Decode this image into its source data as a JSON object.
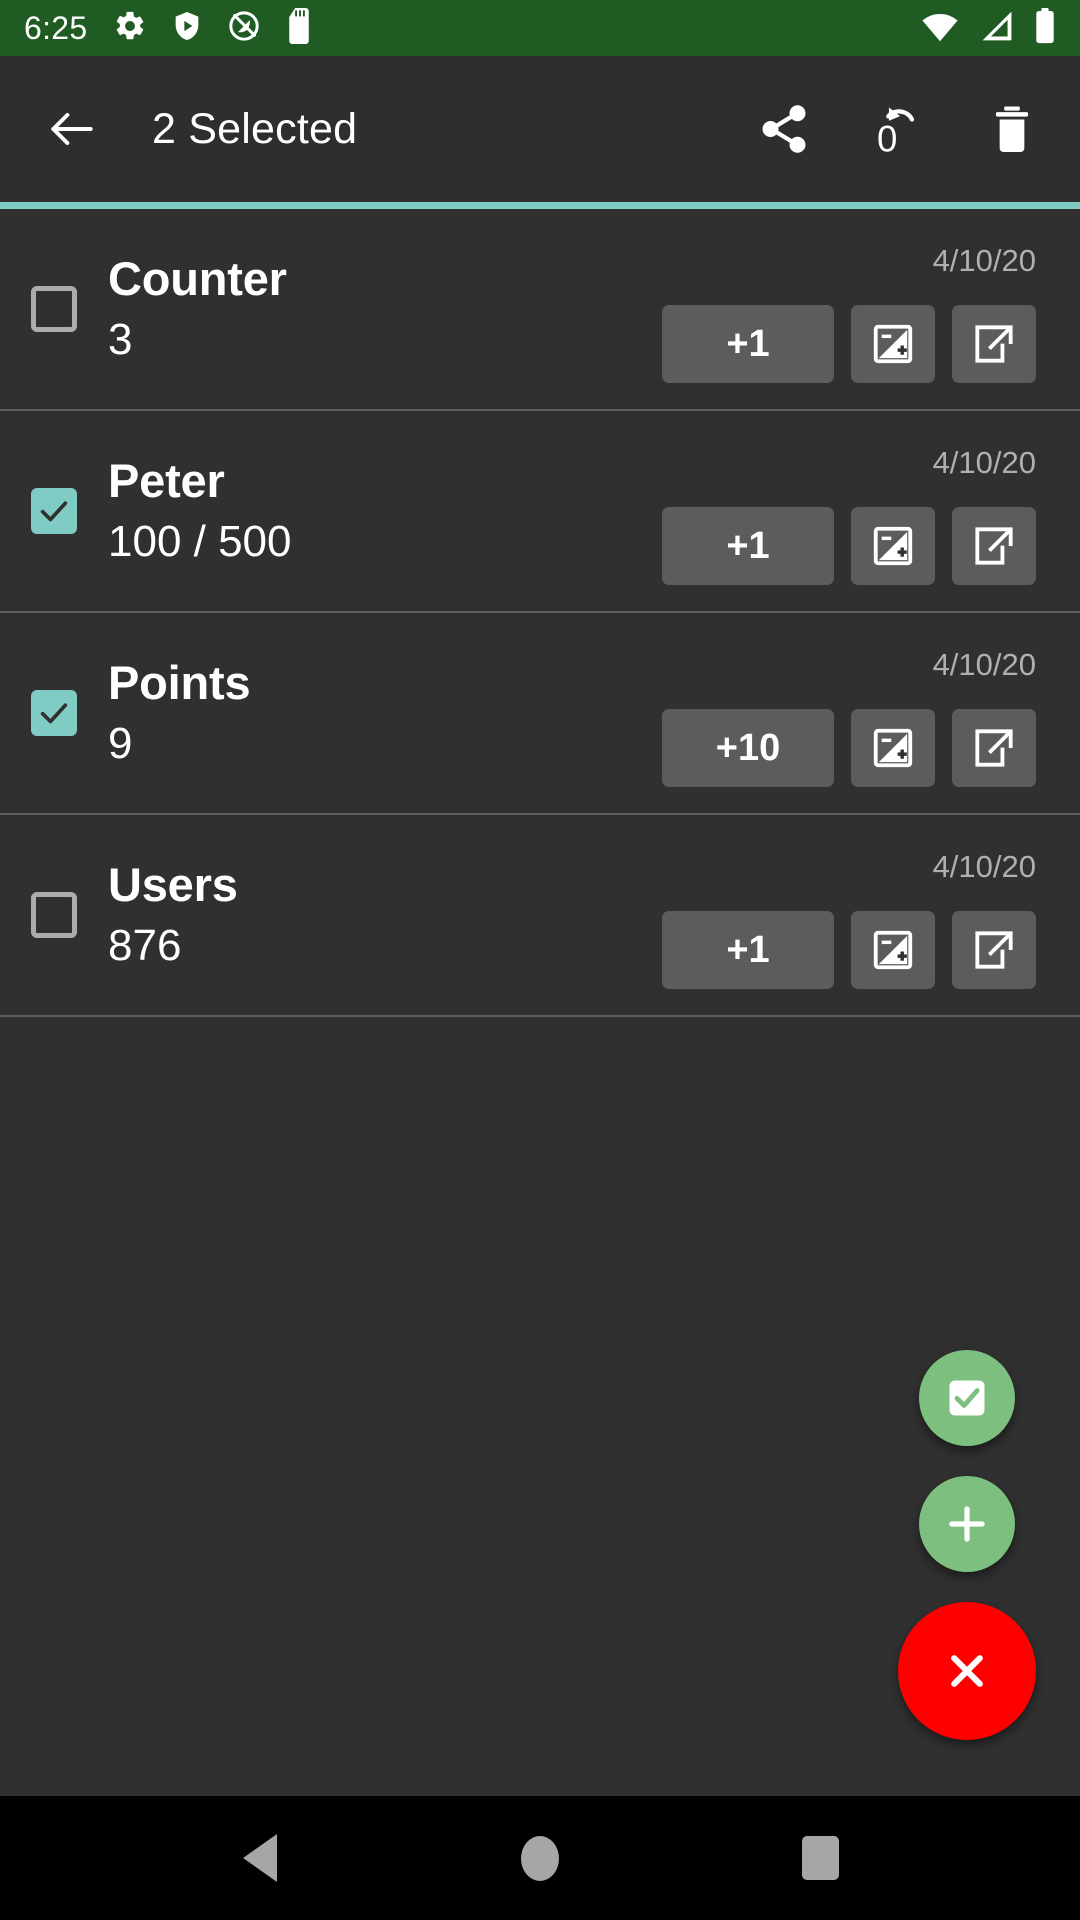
{
  "status_bar": {
    "time": "6:25",
    "background_color": "#1F5B23",
    "left_icons": [
      "gear-icon",
      "play-protect-shield-icon",
      "location-off-icon",
      "sd-card-icon"
    ],
    "right_icons": [
      "wifi-icon",
      "cell-signal-icon",
      "battery-icon"
    ]
  },
  "app_bar": {
    "title": "2 Selected",
    "background_color": "#2E2E2E",
    "back_icon": "arrow-back-icon",
    "actions": [
      {
        "name": "share-button",
        "icon": "share-icon"
      },
      {
        "name": "reset-button",
        "icon": "reset-to-zero-icon"
      },
      {
        "name": "delete-button",
        "icon": "trash-icon"
      }
    ],
    "accent_color": "#80CBC4"
  },
  "list": {
    "checkbox_checked_color": "#80CBC4",
    "checkbox_unchecked_color": "#ACACAC",
    "button_color": "#5C5C5C",
    "rows": [
      {
        "title": "Counter",
        "value": "3",
        "date": "4/10/20",
        "selected": false,
        "increment_label": "+1",
        "edit_icon": "exposure-plus-minus-icon",
        "open_icon": "open-in-new-icon"
      },
      {
        "title": "Peter",
        "value": "100 / 500",
        "date": "4/10/20",
        "selected": true,
        "increment_label": "+1",
        "edit_icon": "exposure-plus-minus-icon",
        "open_icon": "open-in-new-icon"
      },
      {
        "title": "Points",
        "value": "9",
        "date": "4/10/20",
        "selected": true,
        "increment_label": "+10",
        "edit_icon": "exposure-plus-minus-icon",
        "open_icon": "open-in-new-icon"
      },
      {
        "title": "Users",
        "value": "876",
        "date": "4/10/20",
        "selected": false,
        "increment_label": "+1",
        "edit_icon": "exposure-plus-minus-icon",
        "open_icon": "open-in-new-icon"
      }
    ]
  },
  "fabs": [
    {
      "name": "select-all-fab",
      "icon": "check-box-icon",
      "color": "#7CBF7E",
      "size": "small"
    },
    {
      "name": "add-fab",
      "icon": "plus-icon",
      "color": "#7CBF7E",
      "size": "small"
    },
    {
      "name": "cancel-fab",
      "icon": "close-x-icon",
      "color": "#FF0000",
      "size": "large"
    }
  ],
  "nav_bar": {
    "background_color": "#000000",
    "buttons": [
      "back-nav-button",
      "home-nav-button",
      "recents-nav-button"
    ]
  }
}
